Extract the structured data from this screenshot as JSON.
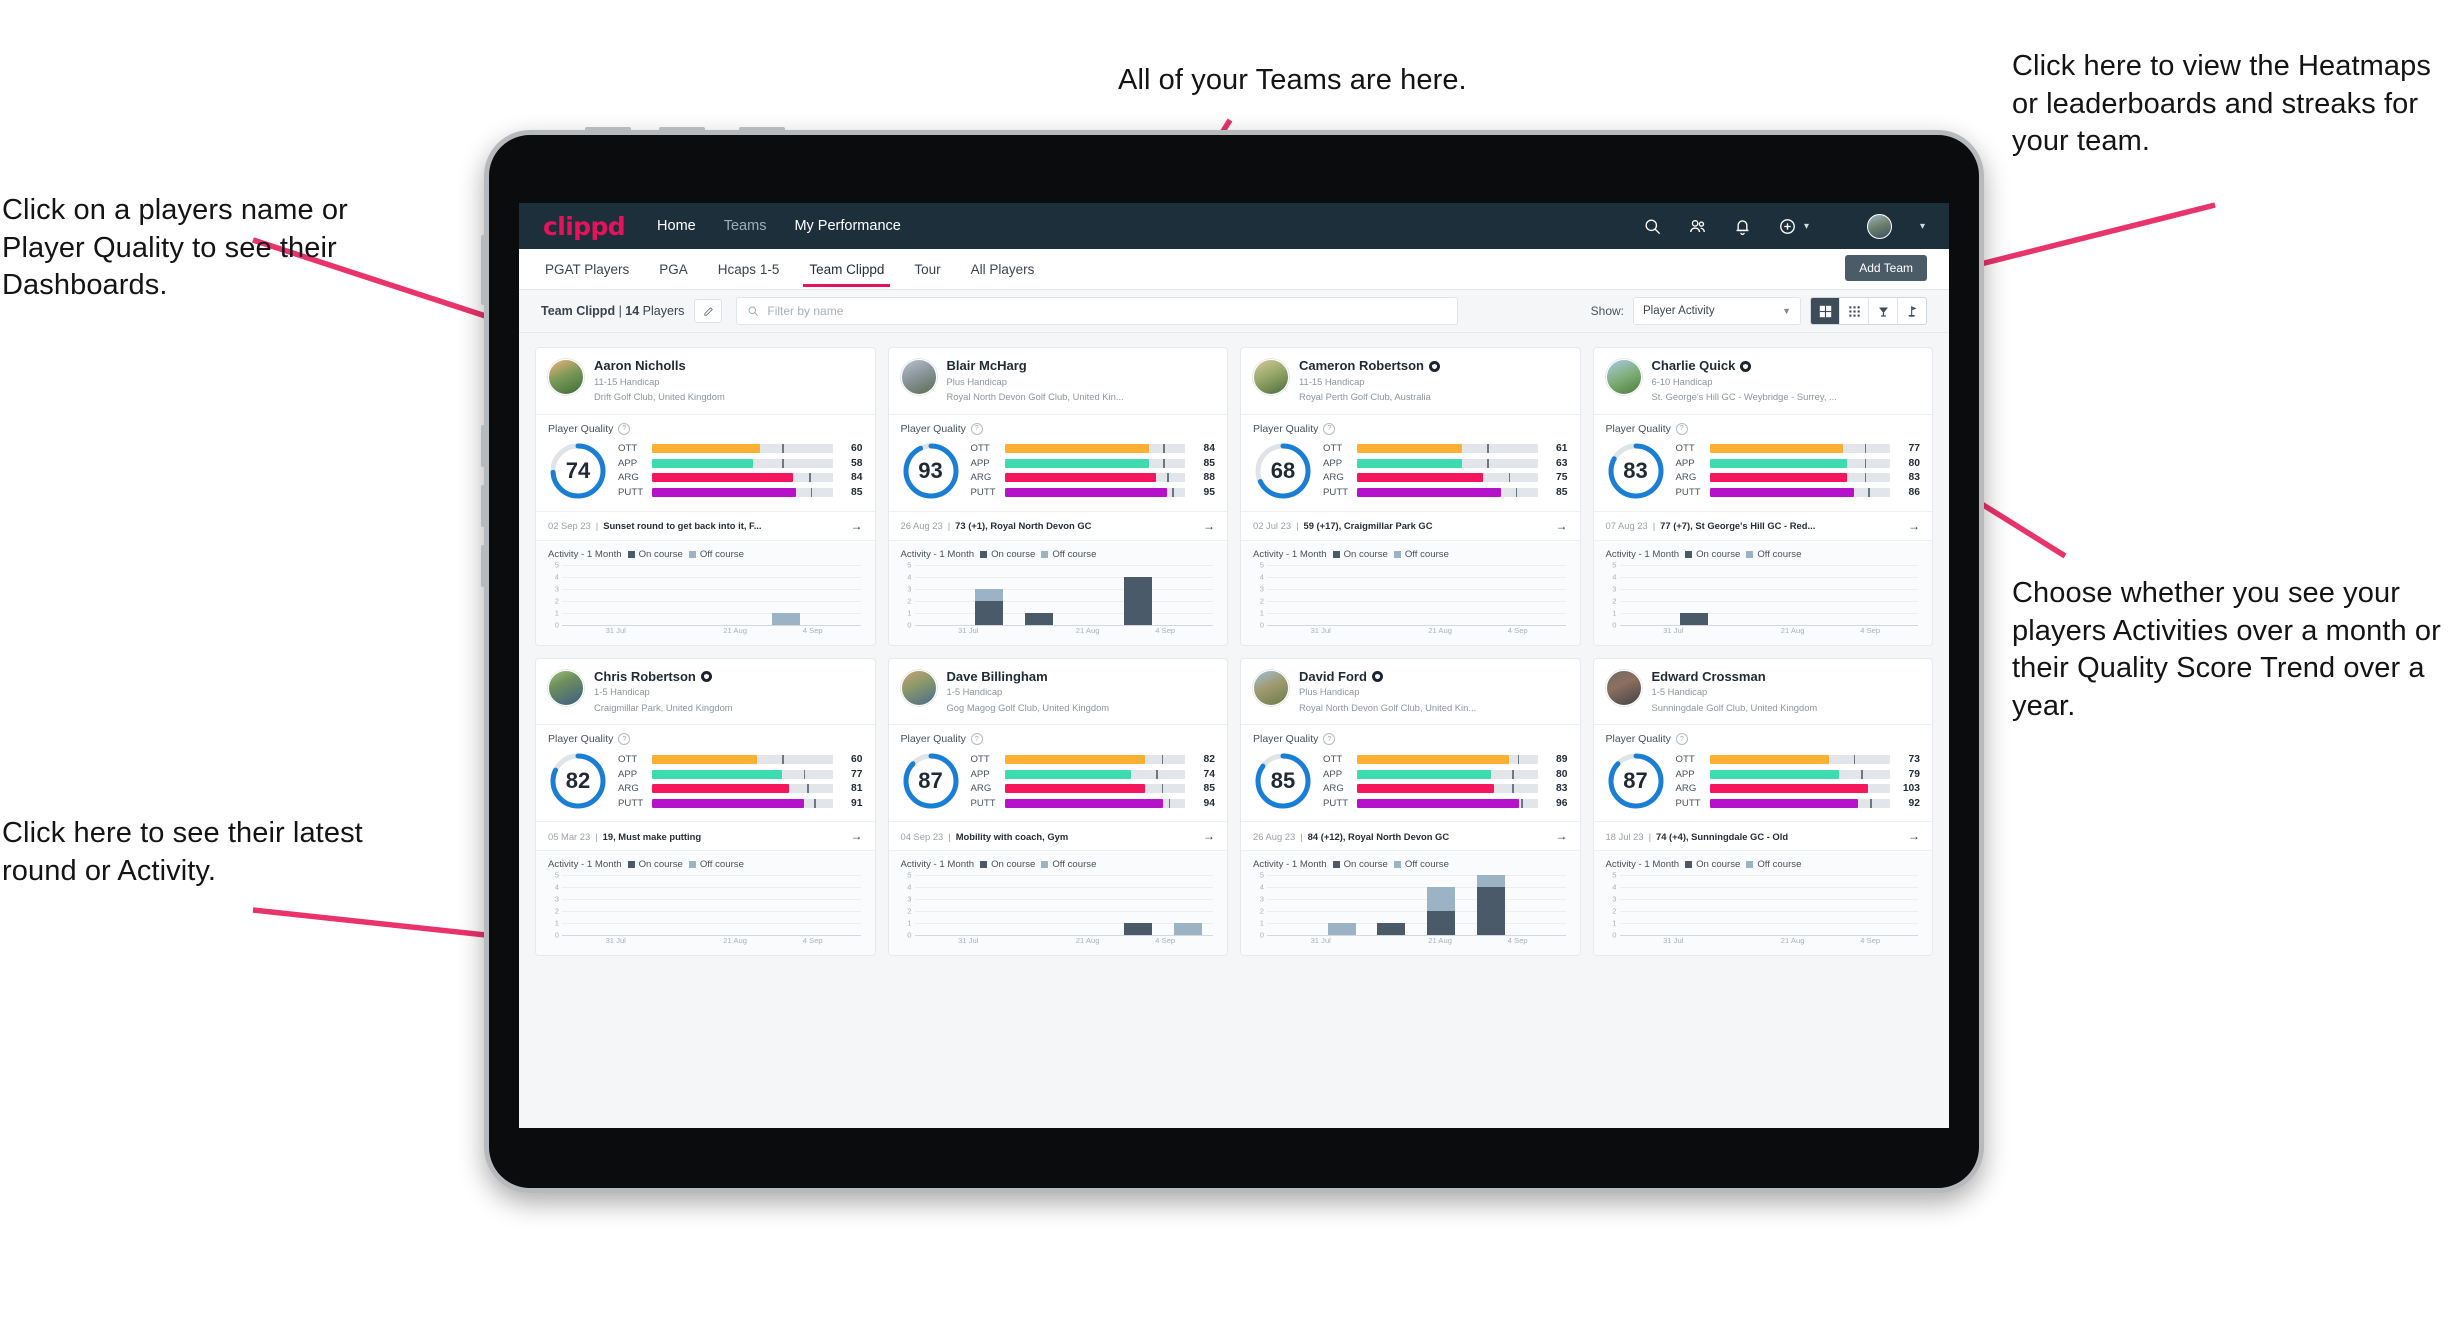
{
  "annotations": {
    "players": "Click on a players name or Player Quality to see their Dashboards.",
    "teams": "All of your Teams are here.",
    "heatmaps": "Click here to view the Heatmaps or leaderboards and streaks for your team.",
    "choose": "Choose whether you see your players Activities over a month or their Quality Score Trend over a year.",
    "latest": "Click here to see their latest round or Activity.",
    "arrow_color": "#e8336b"
  },
  "topnav": {
    "logo": "clippd",
    "links": [
      {
        "label": "Home",
        "active": true
      },
      {
        "label": "Teams",
        "active": false
      },
      {
        "label": "My Performance",
        "active": false
      }
    ],
    "icons": [
      "search-icon",
      "people-icon",
      "bell-icon",
      "plus-circle-icon"
    ],
    "avatar": "user-avatar",
    "bg": "#1e2f3c"
  },
  "tabs": [
    {
      "label": "PGAT Players",
      "active": false
    },
    {
      "label": "PGA",
      "active": false
    },
    {
      "label": "Hcaps 1-5",
      "active": false
    },
    {
      "label": "Team Clippd",
      "active": true
    },
    {
      "label": "Tour",
      "active": false
    },
    {
      "label": "All Players",
      "active": false
    }
  ],
  "add_team_label": "Add Team",
  "filterbar": {
    "team_name": "Team Clippd",
    "separator": " | ",
    "player_count": "14",
    "players_word": " Players",
    "edit_icon": "pencil-icon",
    "search_placeholder": "Filter by name",
    "show_label": "Show:",
    "show_value": "Player Activity",
    "views": [
      {
        "name": "grid-view-icon",
        "selected": true
      },
      {
        "name": "dots-grid-view-icon",
        "selected": false
      },
      {
        "name": "heatmap-trophy-icon",
        "selected": false
      },
      {
        "name": "golf-flag-icon",
        "selected": false
      }
    ]
  },
  "card_labels": {
    "player_quality": "Player Quality",
    "activity": "Activity - 1 Month",
    "legend_on": "On course",
    "legend_off": "Off course",
    "y_ticks": [
      "5",
      "4",
      "3",
      "2",
      "1",
      "0"
    ],
    "x_ticks": [
      "31 Jul",
      "21 Aug",
      "4 Sep"
    ],
    "metric_colors": {
      "OTT": "#fbb034",
      "APP": "#3ddbb0",
      "ARG": "#f5165e",
      "PUTT": "#b512c9",
      "ring": "#1a7fd4",
      "ring_track": "#dfe4e9"
    }
  },
  "players": [
    {
      "name": "Aaron Nicholls",
      "verified": false,
      "handicap": "11-15 Handicap",
      "club": "Drift Golf Club, United Kingdom",
      "avatar_gradient": "linear-gradient(155deg,#f2b27a 0%,#7c9a5a 45%,#3e6b34 100%)",
      "quality": 74,
      "metrics": [
        {
          "label": "OTT",
          "value": 60,
          "fill": 60,
          "tick": 72
        },
        {
          "label": "APP",
          "value": 58,
          "fill": 56,
          "tick": 72
        },
        {
          "label": "ARG",
          "value": 84,
          "fill": 78,
          "tick": 87
        },
        {
          "label": "PUTT",
          "value": 85,
          "fill": 80,
          "tick": 88
        }
      ],
      "round_date": "02 Sep 23",
      "round_text": "Sunset round to get back into it, F...",
      "activity": [
        {
          "on": 0,
          "off": 0
        },
        {
          "on": 0,
          "off": 0
        },
        {
          "on": 0,
          "off": 0
        },
        {
          "on": 0,
          "off": 0
        },
        {
          "on": 0,
          "off": 1
        },
        {
          "on": 0,
          "off": 0
        }
      ]
    },
    {
      "name": "Blair McHarg",
      "verified": false,
      "handicap": "Plus Handicap",
      "club": "Royal North Devon Golf Club, United Kin...",
      "avatar_gradient": "linear-gradient(155deg,#b9c4cc 0%,#8f9aa2 40%,#5b6b52 100%)",
      "quality": 93,
      "metrics": [
        {
          "label": "OTT",
          "value": 84,
          "fill": 80,
          "tick": 88
        },
        {
          "label": "APP",
          "value": 85,
          "fill": 80,
          "tick": 88
        },
        {
          "label": "ARG",
          "value": 88,
          "fill": 84,
          "tick": 90
        },
        {
          "label": "PUTT",
          "value": 95,
          "fill": 90,
          "tick": 93
        }
      ],
      "round_date": "26 Aug 23",
      "round_text": "73 (+1), Royal North Devon GC",
      "activity": [
        {
          "on": 0,
          "off": 0
        },
        {
          "on": 2,
          "off": 1
        },
        {
          "on": 1,
          "off": 0
        },
        {
          "on": 0,
          "off": 0
        },
        {
          "on": 4,
          "off": 0
        },
        {
          "on": 0,
          "off": 0
        }
      ]
    },
    {
      "name": "Cameron Robertson",
      "verified": true,
      "handicap": "11-15 Handicap",
      "club": "Royal Perth Golf Club, Australia",
      "avatar_gradient": "linear-gradient(155deg,#d6c79a 0%,#98a86a 45%,#4c6b3c 100%)",
      "quality": 68,
      "metrics": [
        {
          "label": "OTT",
          "value": 61,
          "fill": 58,
          "tick": 72
        },
        {
          "label": "APP",
          "value": 63,
          "fill": 58,
          "tick": 72
        },
        {
          "label": "ARG",
          "value": 75,
          "fill": 70,
          "tick": 84
        },
        {
          "label": "PUTT",
          "value": 85,
          "fill": 80,
          "tick": 88
        }
      ],
      "round_date": "02 Jul 23",
      "round_text": "59 (+17), Craigmillar Park GC",
      "activity": [
        {
          "on": 0,
          "off": 0
        },
        {
          "on": 0,
          "off": 0
        },
        {
          "on": 0,
          "off": 0
        },
        {
          "on": 0,
          "off": 0
        },
        {
          "on": 0,
          "off": 0
        },
        {
          "on": 0,
          "off": 0
        }
      ]
    },
    {
      "name": "Charlie Quick",
      "verified": true,
      "handicap": "6-10 Handicap",
      "club": "St. George's Hill GC - Weybridge - Surrey, ...",
      "avatar_gradient": "linear-gradient(155deg,#a9cbe6 0%,#7fae78 50%,#4d7c3e 100%)",
      "quality": 83,
      "metrics": [
        {
          "label": "OTT",
          "value": 77,
          "fill": 74,
          "tick": 86
        },
        {
          "label": "APP",
          "value": 80,
          "fill": 76,
          "tick": 86
        },
        {
          "label": "ARG",
          "value": 83,
          "fill": 76,
          "tick": 86
        },
        {
          "label": "PUTT",
          "value": 86,
          "fill": 80,
          "tick": 88
        }
      ],
      "round_date": "07 Aug 23",
      "round_text": "77 (+7), St George's Hill GC - Red...",
      "activity": [
        {
          "on": 0,
          "off": 0
        },
        {
          "on": 1,
          "off": 0
        },
        {
          "on": 0,
          "off": 0
        },
        {
          "on": 0,
          "off": 0
        },
        {
          "on": 0,
          "off": 0
        },
        {
          "on": 0,
          "off": 0
        }
      ]
    },
    {
      "name": "Chris Robertson",
      "verified": true,
      "handicap": "1-5 Handicap",
      "club": "Craigmillar Park, United Kingdom",
      "avatar_gradient": "linear-gradient(155deg,#9fc37e 0%,#6e8f5c 35%,#3e5c86 100%)",
      "quality": 82,
      "metrics": [
        {
          "label": "OTT",
          "value": 60,
          "fill": 58,
          "tick": 72
        },
        {
          "label": "APP",
          "value": 77,
          "fill": 72,
          "tick": 84
        },
        {
          "label": "ARG",
          "value": 81,
          "fill": 76,
          "tick": 86
        },
        {
          "label": "PUTT",
          "value": 91,
          "fill": 84,
          "tick": 90
        }
      ],
      "round_date": "05 Mar 23",
      "round_text": "19, Must make putting",
      "activity": [
        {
          "on": 0,
          "off": 0
        },
        {
          "on": 0,
          "off": 0
        },
        {
          "on": 0,
          "off": 0
        },
        {
          "on": 0,
          "off": 0
        },
        {
          "on": 0,
          "off": 0
        },
        {
          "on": 0,
          "off": 0
        }
      ]
    },
    {
      "name": "Dave Billingham",
      "verified": false,
      "handicap": "1-5 Handicap",
      "club": "Gog Magog Golf Club, United Kingdom",
      "avatar_gradient": "linear-gradient(155deg,#c7a27a 0%,#8d9a6a 40%,#4a6b88 100%)",
      "quality": 87,
      "metrics": [
        {
          "label": "OTT",
          "value": 82,
          "fill": 78,
          "tick": 87
        },
        {
          "label": "APP",
          "value": 74,
          "fill": 70,
          "tick": 84
        },
        {
          "label": "ARG",
          "value": 85,
          "fill": 78,
          "tick": 87
        },
        {
          "label": "PUTT",
          "value": 94,
          "fill": 88,
          "tick": 91
        }
      ],
      "round_date": "04 Sep 23",
      "round_text": "Mobility with coach, Gym",
      "activity": [
        {
          "on": 0,
          "off": 0
        },
        {
          "on": 0,
          "off": 0
        },
        {
          "on": 0,
          "off": 0
        },
        {
          "on": 0,
          "off": 0
        },
        {
          "on": 1,
          "off": 0
        },
        {
          "on": 0,
          "off": 1
        }
      ]
    },
    {
      "name": "David Ford",
      "verified": true,
      "handicap": "Plus Handicap",
      "club": "Royal North Devon Golf Club, United Kin...",
      "avatar_gradient": "linear-gradient(155deg,#9fc0d8 0%,#a09a6f 45%,#6b7a4a 100%)",
      "quality": 85,
      "metrics": [
        {
          "label": "OTT",
          "value": 89,
          "fill": 84,
          "tick": 89
        },
        {
          "label": "APP",
          "value": 80,
          "fill": 74,
          "tick": 86
        },
        {
          "label": "ARG",
          "value": 83,
          "fill": 76,
          "tick": 86
        },
        {
          "label": "PUTT",
          "value": 96,
          "fill": 90,
          "tick": 91
        }
      ],
      "round_date": "26 Aug 23",
      "round_text": "84 (+12), Royal North Devon GC",
      "activity": [
        {
          "on": 0,
          "off": 0
        },
        {
          "on": 0,
          "off": 1
        },
        {
          "on": 1,
          "off": 0
        },
        {
          "on": 2,
          "off": 2
        },
        {
          "on": 4,
          "off": 1
        },
        {
          "on": 0,
          "off": 0
        }
      ]
    },
    {
      "name": "Edward Crossman",
      "verified": false,
      "handicap": "1-5 Handicap",
      "club": "Sunningdale Golf Club, United Kingdom",
      "avatar_gradient": "linear-gradient(155deg,#6e6a66 0%,#8e6f5e 40%,#3f4348 100%)",
      "quality": 87,
      "metrics": [
        {
          "label": "OTT",
          "value": 73,
          "fill": 66,
          "tick": 80
        },
        {
          "label": "APP",
          "value": 79,
          "fill": 72,
          "tick": 84
        },
        {
          "label": "ARG",
          "value": 103,
          "fill": 88,
          "tick": 0
        },
        {
          "label": "PUTT",
          "value": 92,
          "fill": 82,
          "tick": 89
        }
      ],
      "round_date": "18 Jul 23",
      "round_text": "74 (+4), Sunningdale GC - Old",
      "activity": [
        {
          "on": 0,
          "off": 0
        },
        {
          "on": 0,
          "off": 0
        },
        {
          "on": 0,
          "off": 0
        },
        {
          "on": 0,
          "off": 0
        },
        {
          "on": 0,
          "off": 0
        },
        {
          "on": 0,
          "off": 0
        }
      ]
    }
  ]
}
